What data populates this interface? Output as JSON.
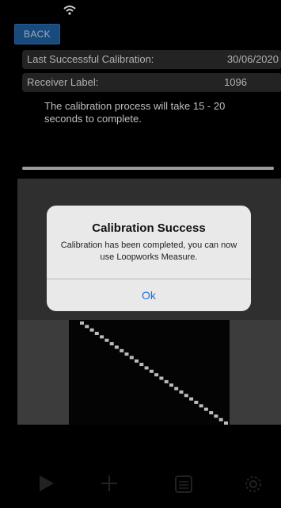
{
  "nav": {
    "back_label": "BACK"
  },
  "info": {
    "last_calibration_label": "Last Successful Calibration:",
    "last_calibration_value": "30/06/2020",
    "receiver_label": "Receiver Label:",
    "receiver_value": "1096"
  },
  "note": "The calibration process will take 15 - 20 seconds to complete.",
  "progress": {
    "fraction": 1.0
  },
  "alert": {
    "title": "Calibration Success",
    "message": "Calibration has been completed, you can now use Loopworks Measure.",
    "ok_label": "Ok",
    "ok_color": "#1a73d9"
  },
  "plot": {
    "points": 30
  },
  "tabbar": {
    "tabs": [
      {
        "icon": "play-icon",
        "label": ""
      },
      {
        "icon": "crosshair-icon",
        "label": ""
      },
      {
        "icon": "list-icon",
        "label": ""
      },
      {
        "icon": "gear-icon",
        "label": ""
      }
    ]
  }
}
